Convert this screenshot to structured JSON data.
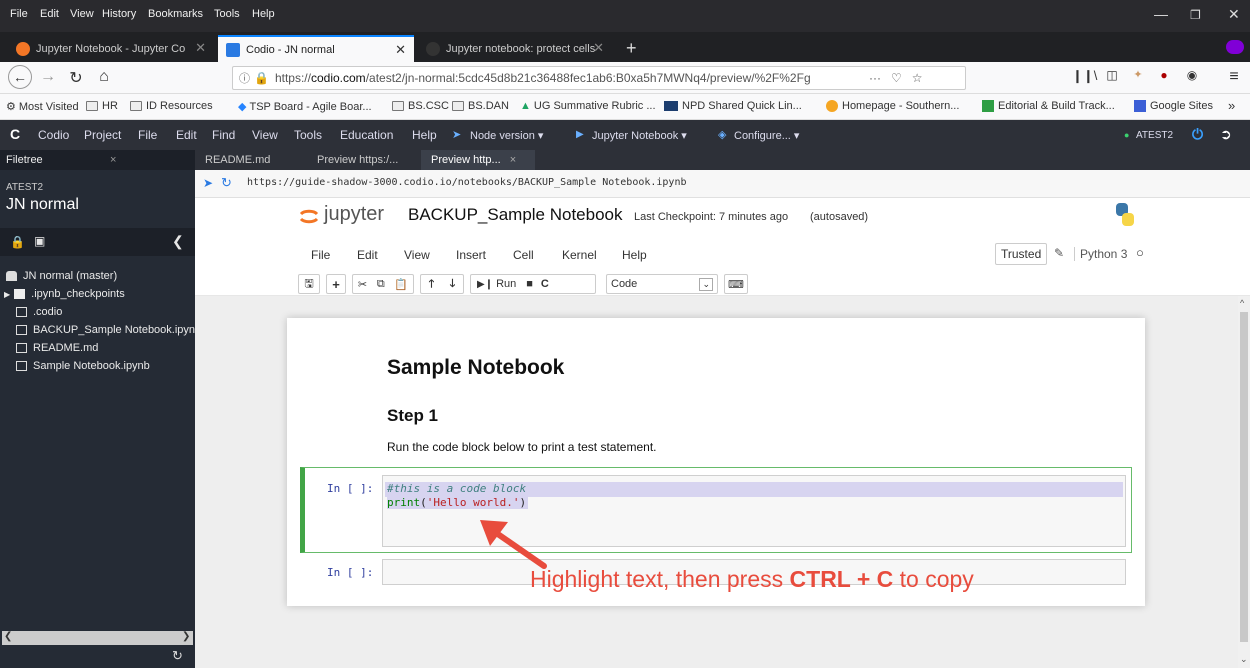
{
  "firefox": {
    "menus": [
      "File",
      "Edit",
      "View",
      "History",
      "Bookmarks",
      "Tools",
      "Help"
    ],
    "tabs": [
      {
        "label": "Jupyter Notebook - Jupyter Co",
        "active": false,
        "icon_color": "#f37626"
      },
      {
        "label": "Codio - JN normal",
        "active": true,
        "icon_color": "#2a7ae2"
      },
      {
        "label": "Jupyter notebook: protect cells",
        "active": false,
        "icon_color": "#333333"
      }
    ],
    "new_tab": "+",
    "url": "https://codio.com/atest2/jn-normal:5cdc45d8b21c36488fec1ab6:B0xa5h7MWNq4/preview/%2F%2Fg",
    "url_domain": "codio.com",
    "url_more": "···",
    "bookmarks": [
      "Most Visited",
      "HR",
      "ID Resources",
      "TSP Board - Agile Boar...",
      "BS.CSC",
      "BS.DAN",
      "UG Summative Rubric ...",
      "NPD Shared Quick Lin...",
      "Homepage - Southern...",
      "Editorial & Build Track...",
      "Google Sites"
    ],
    "bookmarks_overflow": "»"
  },
  "codio": {
    "menus": [
      "Codio",
      "Project",
      "File",
      "Edit",
      "Find",
      "View",
      "Tools",
      "Education",
      "Help"
    ],
    "tools": [
      "Node version ▾",
      "Jupyter Notebook ▾",
      "Configure... ▾"
    ],
    "user": "ATEST2",
    "sidebar": {
      "tab_label": "Filetree",
      "tab_close": "×",
      "owner": "ATEST2",
      "project": "JN normal",
      "items": [
        {
          "label": "JN normal (master)",
          "type": "root"
        },
        {
          "label": ".ipynb_checkpoints",
          "type": "folder"
        },
        {
          "label": ".codio",
          "type": "file"
        },
        {
          "label": "BACKUP_Sample Notebook.ipynb",
          "type": "file"
        },
        {
          "label": "README.md",
          "type": "file"
        },
        {
          "label": "Sample Notebook.ipynb",
          "type": "file"
        }
      ]
    },
    "editor_tabs": [
      {
        "label": "README.md",
        "active": false
      },
      {
        "label": "Preview https:/...",
        "active": false
      },
      {
        "label": "Preview http...",
        "active": true
      }
    ],
    "editor_tab_close": "×",
    "preview_url": "https://guide-shadow-3000.codio.io/notebooks/BACKUP_Sample Notebook.ipynb"
  },
  "jupyter": {
    "logo_text": "jupyter",
    "notebook_name": "BACKUP_Sample Notebook",
    "checkpoint": "Last Checkpoint: 7 minutes ago",
    "autosaved": "(autosaved)",
    "menus": [
      "File",
      "Edit",
      "View",
      "Insert",
      "Cell",
      "Kernel",
      "Help"
    ],
    "trusted": "Trusted",
    "kernel": "Python 3",
    "run_label": "Run",
    "cell_type": "Code",
    "notebook": {
      "heading": "Sample Notebook",
      "subheading": "Step 1",
      "text": "Run the code block below to print a test statement.",
      "cells": [
        {
          "prompt": "In [ ]:",
          "comment": "#this is a code block",
          "code_fn": "print",
          "code_str": "'Hello world.'"
        },
        {
          "prompt": "In [ ]:",
          "code": ""
        }
      ]
    }
  },
  "annotation": {
    "text_before": "Highlight text, then press ",
    "keys": "CTRL + C",
    "text_after": " to copy",
    "color": "#e84c3d"
  }
}
